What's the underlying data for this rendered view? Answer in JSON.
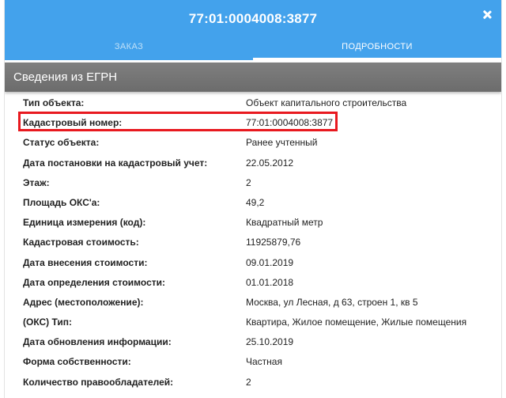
{
  "header": {
    "title": "77:01:0004008:3877",
    "tabs": [
      {
        "label": "ЗАКАЗ"
      },
      {
        "label": "ПОДРОБНОСТИ"
      }
    ],
    "close_icon": "close-icon"
  },
  "section": {
    "title": "Сведения из ЕГРН"
  },
  "rows": [
    {
      "label": "Тип объекта:",
      "value": "Объект капитального строительства"
    },
    {
      "label": "Кадастровый номер:",
      "value": "77:01:0004008:3877"
    },
    {
      "label": "Статус объекта:",
      "value": "Ранее учтенный"
    },
    {
      "label": "Дата постановки на кадастровый учет:",
      "value": "22.05.2012"
    },
    {
      "label": "Этаж:",
      "value": "2"
    },
    {
      "label": "Площадь ОКС'a:",
      "value": "49,2"
    },
    {
      "label": "Единица измерения (код):",
      "value": "Квадратный метр"
    },
    {
      "label": "Кадастровая стоимость:",
      "value": "11925879,76"
    },
    {
      "label": "Дата внесения стоимости:",
      "value": "09.01.2019"
    },
    {
      "label": "Дата определения стоимости:",
      "value": "01.01.2018"
    },
    {
      "label": "Адрес (местоположение):",
      "value": "Москва, ул Лесная, д 63, строен 1, кв 5"
    },
    {
      "label": "(ОКС) Тип:",
      "value": "Квартира, Жилое помещение, Жилые помещения"
    },
    {
      "label": "Дата обновления информации:",
      "value": "25.10.2019"
    },
    {
      "label": "Форма собственности:",
      "value": "Частная"
    },
    {
      "label": "Количество правообладателей:",
      "value": "2"
    }
  ],
  "colors": {
    "header": "#43a2ec",
    "section_bar": "#757575",
    "highlight": "#e8191f"
  }
}
